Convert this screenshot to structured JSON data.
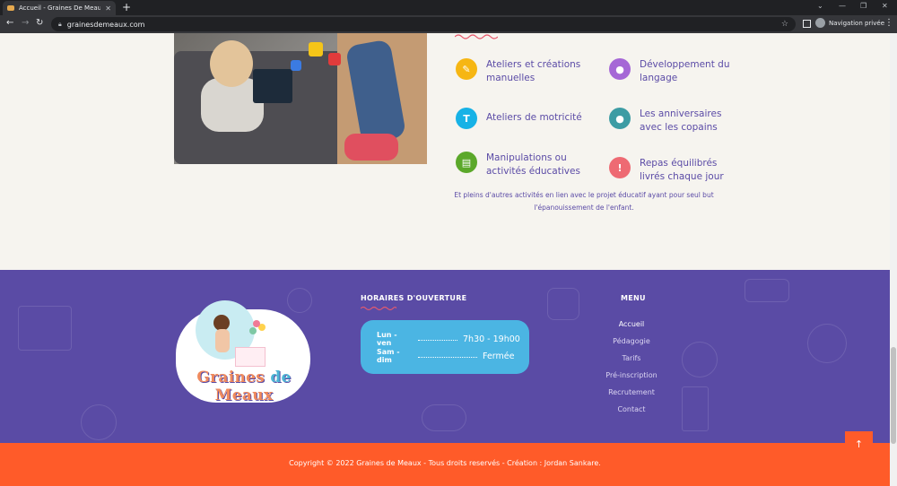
{
  "browser": {
    "tab_title": "Accueil - Graines De Meaux",
    "tab_close": "✕",
    "new_tab": "+",
    "url": "grainesdemeaux.com",
    "profile_label": "Navigation privée",
    "win_min": "—",
    "win_restore": "❐",
    "win_close": "✕",
    "win_dropdown": "⌄"
  },
  "activities": [
    {
      "label": "Ateliers et créations manuelles",
      "color": "#f6b613",
      "icon": "pencil-icon",
      "glyph": "✎"
    },
    {
      "label": "Développement du langage",
      "color": "#a567d6",
      "icon": "speech-bubble-icon",
      "glyph": "●"
    },
    {
      "label": "Ateliers de motricité",
      "color": "#17b2e6",
      "icon": "letter-t-icon",
      "glyph": "T"
    },
    {
      "label": "Les anniversaires avec les copains",
      "color": "#3d9ca4",
      "icon": "drop-icon",
      "glyph": "●"
    },
    {
      "label": "Manipulations ou activités éducatives",
      "color": "#5ba82a",
      "icon": "card-icon",
      "glyph": "▤"
    },
    {
      "label": "Repas équilibrés livrés chaque jour",
      "color": "#ee6a73",
      "icon": "exclamation-icon",
      "glyph": "!"
    }
  ],
  "footnote": "Et pleins d'autres activités en lien avec le projet éducatif ayant pour seul but l'épanouissement de l'enfant.",
  "footer": {
    "logo_text_1": "Graines",
    "logo_text_2": " de ",
    "logo_text_3": "Meaux",
    "hours_title": "HORAIRES D'OUVERTURE",
    "hours": [
      {
        "day": "Lun - ven",
        "time": "7h30 - 19h00"
      },
      {
        "day": "Sam - dim",
        "time": "Fermée"
      }
    ],
    "menu_title": "MENU",
    "menu": [
      "Accueil",
      "Pédagogie",
      "Tarifs",
      "Pré-inscription",
      "Recrutement",
      "Contact"
    ],
    "to_top": "↑",
    "copyright": "Copyright © 2022 Graines de Meaux - Tous droits reservés - Création : Jordan Sankare."
  },
  "colors": {
    "accent_purple": "#5a4ba5",
    "accent_orange": "#ff5b29",
    "accent_blue": "#4bb5e3",
    "wave_red": "#e85a6d"
  }
}
